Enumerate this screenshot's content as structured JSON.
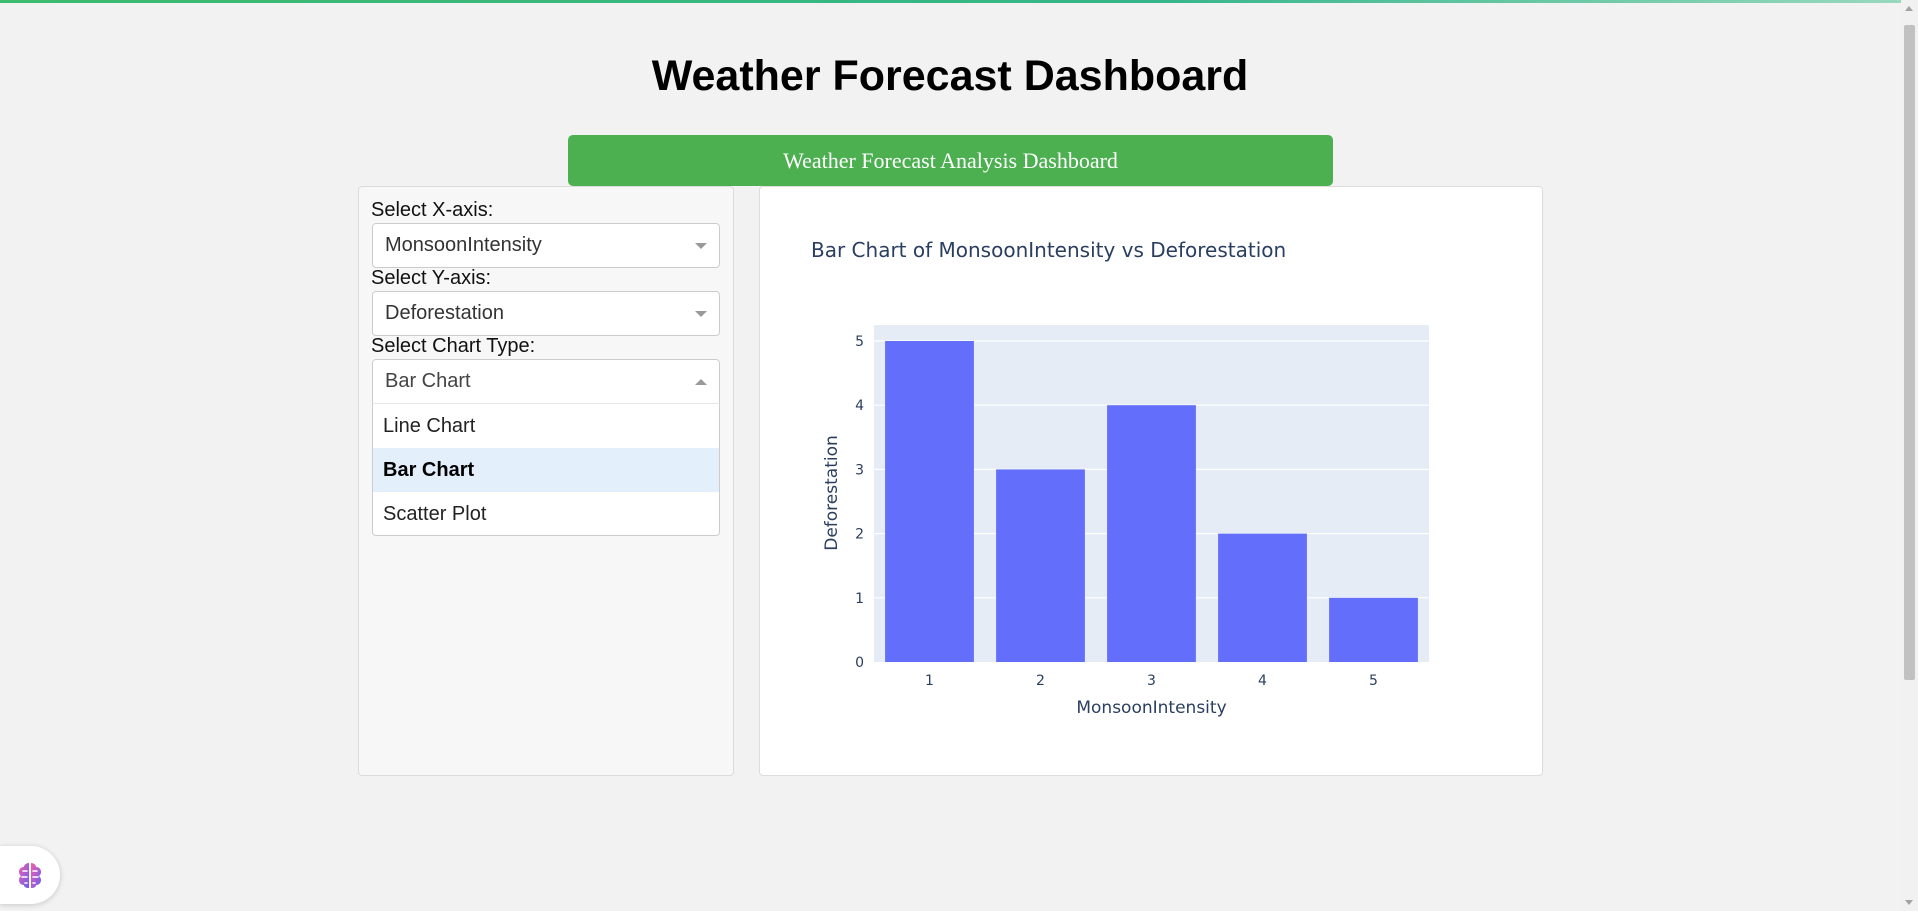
{
  "page": {
    "title": "Weather Forecast Dashboard",
    "banner": "Weather Forecast Analysis Dashboard"
  },
  "controls": {
    "x_axis": {
      "label": "Select X-axis:",
      "value": "MonsoonIntensity"
    },
    "y_axis": {
      "label": "Select Y-axis:",
      "value": "Deforestation"
    },
    "chart_type": {
      "label": "Select Chart Type:",
      "value": "Bar Chart",
      "options": [
        "Line Chart",
        "Bar Chart",
        "Scatter Plot"
      ]
    }
  },
  "colors": {
    "banner_bg": "#4caf50",
    "bar_fill": "#636efa",
    "plot_bg": "#e5ecf6",
    "menu_selected": "#e3f0fb"
  },
  "icons": {
    "assistant": "brain-icon"
  },
  "chart_data": {
    "type": "bar",
    "title": "Bar Chart of MonsoonIntensity vs Deforestation",
    "xlabel": "MonsoonIntensity",
    "ylabel": "Deforestation",
    "categories": [
      "1",
      "2",
      "3",
      "4",
      "5"
    ],
    "values": [
      5,
      3,
      4,
      2,
      1
    ],
    "ylim": [
      0,
      5
    ],
    "yticks": [
      "0",
      "1",
      "2",
      "3",
      "4",
      "5"
    ],
    "grid": true
  }
}
